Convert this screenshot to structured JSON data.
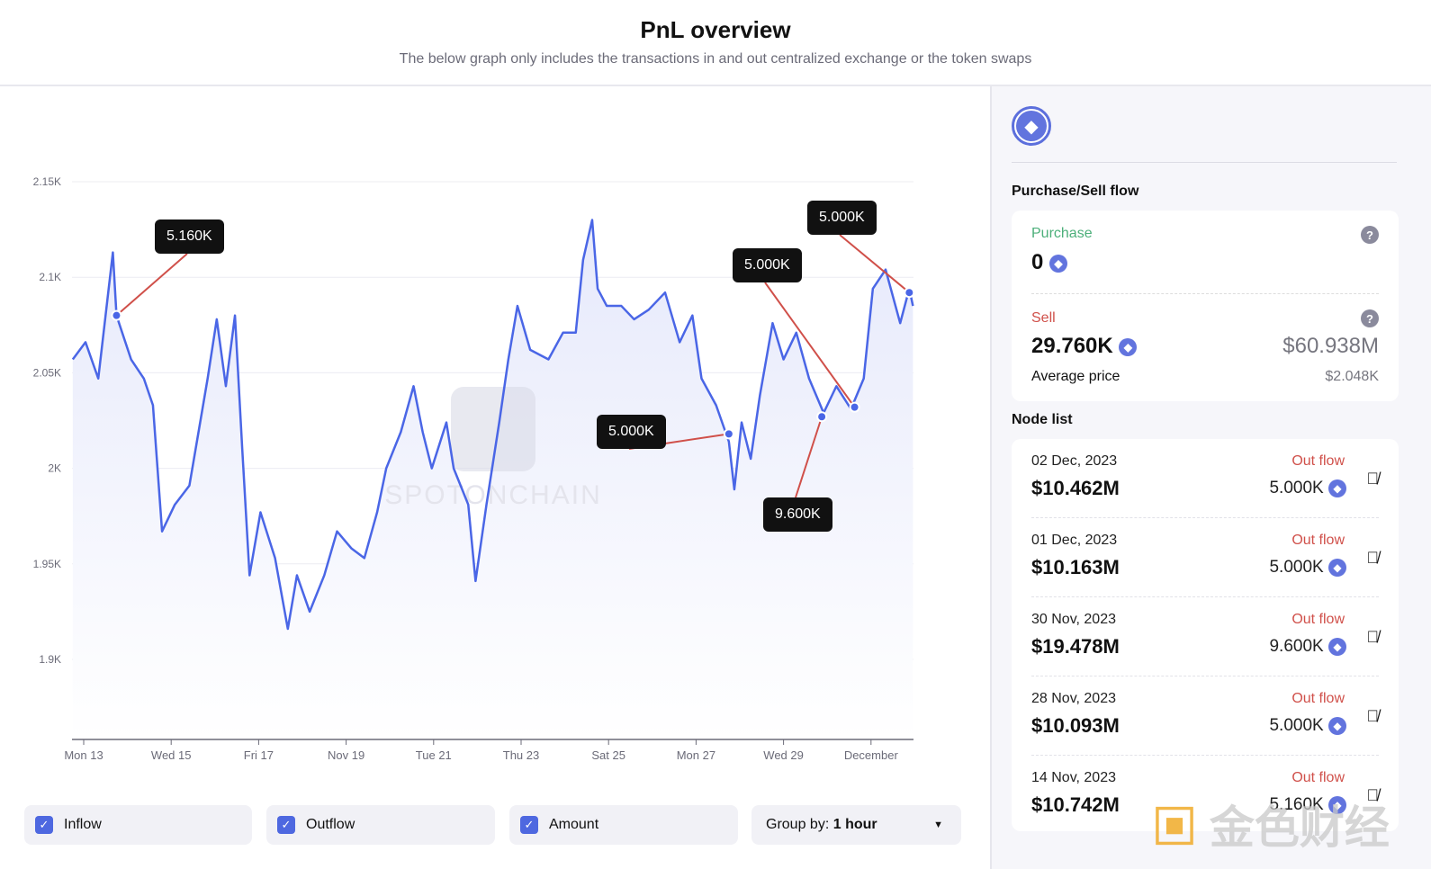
{
  "header": {
    "title": "PnL overview",
    "subtitle": "The below graph only includes the transactions in and out centralized exchange or the token swaps"
  },
  "chart_data": {
    "type": "line",
    "title": "",
    "xlabel": "",
    "ylabel": "",
    "ylim": [
      1850,
      2150
    ],
    "grid": true,
    "y_ticks": [
      "2.15K",
      "2.1K",
      "2.05K",
      "2K",
      "1.95K",
      "1.9K"
    ],
    "y_tick_values": [
      2150,
      2100,
      2050,
      2000,
      1950,
      1900
    ],
    "x_ticks": [
      "Mon 13",
      "Wed 15",
      "Fri 17",
      "Nov 19",
      "Tue 21",
      "Thu 23",
      "Sat 25",
      "Mon 27",
      "Wed 29",
      "December"
    ],
    "x_tick_dates": [
      "2023-11-13T00:00",
      "2023-11-15T00:00",
      "2023-11-17T00:00",
      "2023-11-19T00:00",
      "2023-11-21T00:00",
      "2023-11-23T00:00",
      "2023-11-25T00:00",
      "2023-11-27T00:00",
      "2023-11-29T00:00",
      "2023-12-01T00:00"
    ],
    "line_color": "#4a66e6",
    "series": [
      {
        "points": [
          [
            "2023-11-12T18:00",
            2057
          ],
          [
            "2023-11-13T01:00",
            2066
          ],
          [
            "2023-11-13T08:00",
            2047
          ],
          [
            "2023-11-13T16:00",
            2113
          ],
          [
            "2023-11-13T18:00",
            2080
          ],
          [
            "2023-11-14T02:00",
            2057
          ],
          [
            "2023-11-14T09:00",
            2047
          ],
          [
            "2023-11-14T14:00",
            2033
          ],
          [
            "2023-11-14T19:00",
            1967
          ],
          [
            "2023-11-15T02:00",
            1981
          ],
          [
            "2023-11-15T10:00",
            1991
          ],
          [
            "2023-11-15T15:00",
            2019
          ],
          [
            "2023-11-15T20:00",
            2047
          ],
          [
            "2023-11-16T01:00",
            2078
          ],
          [
            "2023-11-16T06:00",
            2043
          ],
          [
            "2023-11-16T11:00",
            2080
          ],
          [
            "2023-11-16T15:00",
            2010
          ],
          [
            "2023-11-16T19:00",
            1944
          ],
          [
            "2023-11-17T01:00",
            1977
          ],
          [
            "2023-11-17T09:00",
            1953
          ],
          [
            "2023-11-17T16:00",
            1916
          ],
          [
            "2023-11-17T21:00",
            1944
          ],
          [
            "2023-11-18T04:00",
            1925
          ],
          [
            "2023-11-18T12:00",
            1944
          ],
          [
            "2023-11-18T19:00",
            1967
          ],
          [
            "2023-11-19T03:00",
            1958
          ],
          [
            "2023-11-19T10:00",
            1953
          ],
          [
            "2023-11-19T17:00",
            1977
          ],
          [
            "2023-11-19T22:00",
            2000
          ],
          [
            "2023-11-20T06:00",
            2019
          ],
          [
            "2023-11-20T13:00",
            2043
          ],
          [
            "2023-11-20T18:00",
            2019
          ],
          [
            "2023-11-20T23:00",
            2000
          ],
          [
            "2023-11-21T07:00",
            2024
          ],
          [
            "2023-11-21T11:00",
            2000
          ],
          [
            "2023-11-21T19:00",
            1981
          ],
          [
            "2023-11-21T23:00",
            1941
          ],
          [
            "2023-11-22T05:00",
            1981
          ],
          [
            "2023-11-22T12:00",
            2024
          ],
          [
            "2023-11-22T17:00",
            2057
          ],
          [
            "2023-11-22T22:00",
            2085
          ],
          [
            "2023-11-23T05:00",
            2062
          ],
          [
            "2023-11-23T15:00",
            2057
          ],
          [
            "2023-11-23T23:00",
            2071
          ],
          [
            "2023-11-24T06:00",
            2071
          ],
          [
            "2023-11-24T10:00",
            2109
          ],
          [
            "2023-11-24T15:00",
            2130
          ],
          [
            "2023-11-24T18:00",
            2094
          ],
          [
            "2023-11-24T23:00",
            2085
          ],
          [
            "2023-11-25T07:00",
            2085
          ],
          [
            "2023-11-25T14:00",
            2078
          ],
          [
            "2023-11-25T22:00",
            2083
          ],
          [
            "2023-11-26T07:00",
            2092
          ],
          [
            "2023-11-26T15:00",
            2066
          ],
          [
            "2023-11-26T22:00",
            2080
          ],
          [
            "2023-11-27T03:00",
            2047
          ],
          [
            "2023-11-27T11:00",
            2033
          ],
          [
            "2023-11-27T18:00",
            2014
          ],
          [
            "2023-11-27T21:00",
            1989
          ],
          [
            "2023-11-28T01:00",
            2024
          ],
          [
            "2023-11-28T06:00",
            2005
          ],
          [
            "2023-11-28T11:00",
            2038
          ],
          [
            "2023-11-28T18:00",
            2076
          ],
          [
            "2023-11-29T00:00",
            2057
          ],
          [
            "2023-11-29T07:00",
            2071
          ],
          [
            "2023-11-29T14:00",
            2047
          ],
          [
            "2023-11-29T22:00",
            2029
          ],
          [
            "2023-11-30T05:00",
            2043
          ],
          [
            "2023-11-30T13:00",
            2031
          ],
          [
            "2023-11-30T20:00",
            2047
          ],
          [
            "2023-12-01T01:00",
            2094
          ],
          [
            "2023-12-01T08:00",
            2104
          ],
          [
            "2023-12-01T16:00",
            2076
          ],
          [
            "2023-12-01T21:00",
            2094
          ],
          [
            "2023-12-01T23:00",
            2085
          ]
        ]
      }
    ],
    "annotations": [
      {
        "date": "2023-11-13T18:00",
        "price": 2080,
        "label": "5.160K"
      },
      {
        "date": "2023-11-27T18:00",
        "price": 2018,
        "label": "5.000K"
      },
      {
        "date": "2023-11-29T21:00",
        "price": 2027,
        "label": "9.600K"
      },
      {
        "date": "2023-11-30T15:00",
        "price": 2032,
        "label": "5.000K"
      },
      {
        "date": "2023-12-01T21:00",
        "price": 2092,
        "label": "5.000K"
      }
    ],
    "watermark": "SPOTONCHAIN"
  },
  "controls": {
    "inflow": "Inflow",
    "outflow": "Outflow",
    "amount": "Amount",
    "group_by_label": "Group by:",
    "group_by_value": "1 hour"
  },
  "panel": {
    "flow_title": "Purchase/Sell flow",
    "purchase_label": "Purchase",
    "purchase_amount": "0",
    "sell_label": "Sell",
    "sell_amount": "29.760K",
    "sell_usd": "$60.938M",
    "avg_label": "Average price",
    "avg_value": "$2.048K",
    "node_title": "Node list",
    "nodes": [
      {
        "date": "02 Dec, 2023",
        "value": "$10.462M",
        "flow": "Out flow",
        "amount": "5.000K"
      },
      {
        "date": "01 Dec, 2023",
        "value": "$10.163M",
        "flow": "Out flow",
        "amount": "5.000K"
      },
      {
        "date": "30 Nov, 2023",
        "value": "$19.478M",
        "flow": "Out flow",
        "amount": "9.600K"
      },
      {
        "date": "28 Nov, 2023",
        "value": "$10.093M",
        "flow": "Out flow",
        "amount": "5.000K"
      },
      {
        "date": "14 Nov, 2023",
        "value": "$10.742M",
        "flow": "Out flow",
        "amount": "5.160K"
      }
    ],
    "colors": {
      "purchase": "#4caf7a",
      "sell": "#d0504a",
      "eth": "#6274de"
    }
  },
  "watermark_logo": "金色财经"
}
